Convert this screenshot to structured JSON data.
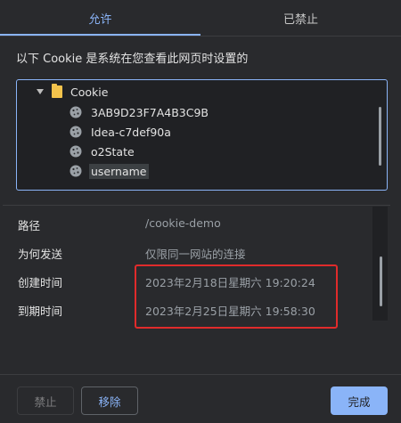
{
  "tabs": [
    {
      "label": "允许",
      "active": true
    },
    {
      "label": "已禁止",
      "active": false
    }
  ],
  "description": "以下 Cookie 是系统在您查看此网页时设置的",
  "tree": {
    "root_label": "Cookie",
    "cookies": [
      {
        "name": "3AB9D23F7A4B3C9B"
      },
      {
        "name": "Idea-c7def90a"
      },
      {
        "name": "o2State"
      },
      {
        "name": "username",
        "selected": true
      }
    ]
  },
  "details": [
    {
      "label": "路径",
      "value": "/cookie-demo"
    },
    {
      "label": "为何发送",
      "value": "仅限同一网站的连接"
    },
    {
      "label": "创建时间",
      "value": "2023年2月18日星期六 19:20:24"
    },
    {
      "label": "到期时间",
      "value": "2023年2月25日星期六 19:58:30"
    }
  ],
  "buttons": {
    "block": "禁止",
    "remove": "移除",
    "done": "完成"
  },
  "colors": {
    "accent": "#8ab4f8",
    "highlight": "#e02b2b",
    "folder": "#f3c34c"
  }
}
